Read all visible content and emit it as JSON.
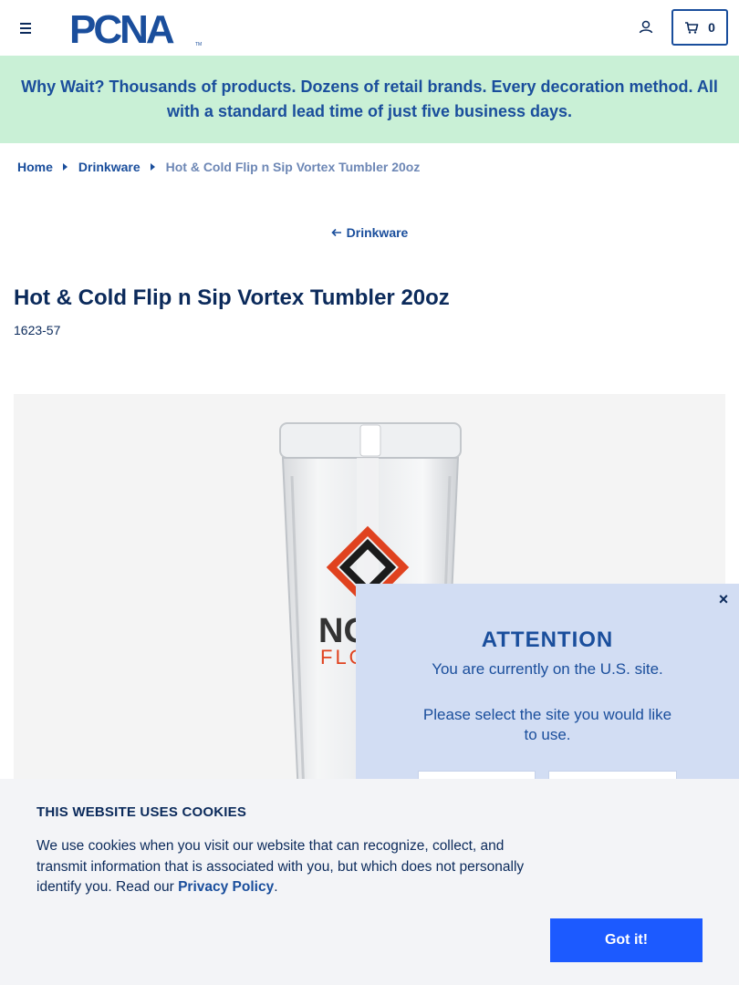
{
  "header": {
    "logo_text": "PCNA",
    "logo_tm": "TM",
    "cart_count": "0",
    "icons": {
      "menu": "hamburger-menu-icon",
      "account": "user-icon",
      "cart": "cart-icon"
    }
  },
  "promo": {
    "text": "Why Wait? Thousands of products. Dozens of retail brands. Every decoration method. All with a standard lead time of just five business days."
  },
  "breadcrumb": {
    "items": [
      "Home",
      "Drinkware"
    ],
    "current": "Hot & Cold Flip n Sip Vortex Tumbler 20oz"
  },
  "back_link": {
    "label": "Drinkware"
  },
  "product": {
    "title": "Hot & Cold Flip n Sip Vortex Tumbler 20oz",
    "sku": "1623-57",
    "imprint_text_1": "NO",
    "imprint_text_2": "FLO"
  },
  "modal": {
    "title": "ATTENTION",
    "line1": "You are currently on the U.S. site.",
    "line2": "Please select the site you would like to use.",
    "close": "×"
  },
  "cookie": {
    "title": "THIS WEBSITE USES COOKIES",
    "text_before": "We use cookies when you visit our website that can recognize, collect, and transmit information that is associated with you, but which does not personally identify you. Read our ",
    "link": "Privacy Policy",
    "text_after": ".",
    "button": "Got it!"
  },
  "colors": {
    "navy": "#0b2a5b",
    "brand_blue": "#1a4e9c",
    "promo_bg": "#c9f0d6",
    "modal_bg": "#d2ddf3",
    "cookie_bg": "#f3f4f7",
    "button_blue": "#1c5aff"
  }
}
